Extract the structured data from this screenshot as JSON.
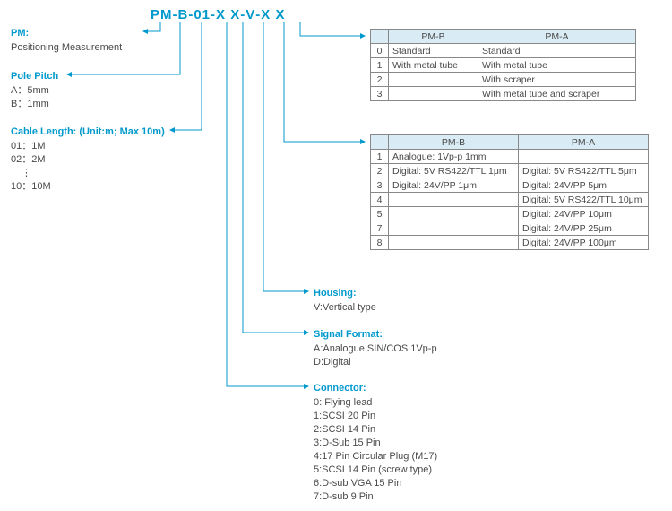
{
  "partno": [
    "PM",
    "-",
    "B",
    "-",
    "01",
    "-",
    "X",
    "X",
    "-",
    "V",
    "-",
    "X",
    "X"
  ],
  "pm": {
    "hdr": "PM:",
    "line": "Positioning Measurement"
  },
  "pole": {
    "hdr": "Pole Pitch",
    "a": "A：5mm",
    "b": "B：1mm"
  },
  "cable": {
    "hdr": "Cable Length: (Unit:m; Max 10m)",
    "l1": "01：1M",
    "l2": "02：2M",
    "dot": "⋮",
    "l10": "10：10M"
  },
  "housing": {
    "hdr": "Housing:",
    "l1": "V:Vertical type"
  },
  "signal": {
    "hdr": "Signal Format:",
    "l1": "A:Analogue SIN/COS 1Vp-p",
    "l2": "D:Digital"
  },
  "connector": {
    "hdr": "Connector:",
    "l0": "0: Flying lead",
    "l1": "1:SCSI 20 Pin",
    "l2": "2:SCSI 14 Pin",
    "l3": "3:D-Sub 15 Pin",
    "l4": "4:17 Pin Circular Plug (M17)",
    "l5": "5:SCSI 14 Pin (screw type)",
    "l6": "6:D-sub VGA 15 Pin",
    "l7": "7:D-sub 9 Pin"
  },
  "t1": {
    "hb": "PM-B",
    "ha": "PM-A",
    "rows": [
      {
        "i": "0",
        "b": "Standard",
        "a": "Standard"
      },
      {
        "i": "1",
        "b": "With metal tube",
        "a": "With metal tube"
      },
      {
        "i": "2",
        "b": "",
        "a": "With scraper"
      },
      {
        "i": "3",
        "b": "",
        "a": "With metal tube and scraper"
      }
    ]
  },
  "t2": {
    "hb": "PM-B",
    "ha": "PM-A",
    "rows": [
      {
        "i": "1",
        "b": "Analogue: 1Vp-p 1mm",
        "a": ""
      },
      {
        "i": "2",
        "b": "Digital: 5V RS422/TTL 1μm",
        "a": "Digital: 5V RS422/TTL 5μm"
      },
      {
        "i": "3",
        "b": "Digital: 24V/PP 1μm",
        "a": "Digital: 24V/PP 5μm"
      },
      {
        "i": "4",
        "b": "",
        "a": "Digital: 5V RS422/TTL 10μm"
      },
      {
        "i": "5",
        "b": "",
        "a": "Digital: 24V/PP 10μm"
      },
      {
        "i": "7",
        "b": "",
        "a": "Digital: 24V/PP 25μm"
      },
      {
        "i": "8",
        "b": "",
        "a": "Digital: 24V/PP 100μm"
      }
    ]
  }
}
